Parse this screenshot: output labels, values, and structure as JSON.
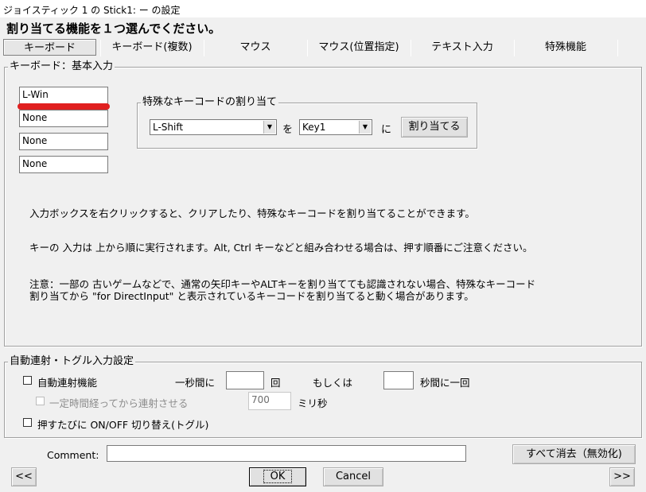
{
  "window": {
    "title": "ジョイスティック 1 の Stick1: ー の設定"
  },
  "heading": "割り当てる機能を１つ選んでください。",
  "tabs": [
    {
      "label": "キーボード",
      "active": true
    },
    {
      "label": "キーボード(複数)",
      "active": false
    },
    {
      "label": "マウス",
      "active": false
    },
    {
      "label": "マウス(位置指定)",
      "active": false
    },
    {
      "label": "テキスト入力",
      "active": false
    },
    {
      "label": "特殊機能",
      "active": false
    }
  ],
  "keyboard_group": {
    "label": "キーボード：基本入力",
    "key_inputs": [
      "L-Win",
      "None",
      "None",
      "None"
    ],
    "special": {
      "label": "特殊なキーコードの割り当て",
      "source_key": "L-Shift",
      "wo": "を",
      "target_key": "Key1",
      "ni": "に",
      "assign_button": "割り当てる"
    },
    "info": {
      "line1": "入力ボックスを右クリックすると、クリアしたり、特殊なキーコードを割り当てることができます。",
      "line2": "キーの 入力は 上から順に実行されます。Alt, Ctrl キーなどと組み合わせる場合は、押す順番にご注意ください。",
      "line3a": "注意：一部の 古いゲームなどで、通常の矢印キーやALTキーを割り当てても認識されない場合、特殊なキーコード",
      "line3b": "割り当てから \"for DirectInput\" と表示されているキーコードを割り当てると動く場合があります。"
    }
  },
  "autofire_group": {
    "label": "自動連射・トグル入力設定",
    "autofire_label": "自動連射機能",
    "per_second_label": "一秒間に",
    "per_second_value": "",
    "times_label": "回",
    "or_label": "もしくは",
    "seconds_value": "",
    "seconds_label": "秒間に一回",
    "delay_label": "一定時間経ってから連射させる",
    "delay_value": "700",
    "ms_label": "ミリ秒",
    "toggle_label": "押すたびに ON/OFF 切り替え(トグル)"
  },
  "comment": {
    "label": "Comment:",
    "value": ""
  },
  "buttons": {
    "clear_all": "すべて消去（無効化)",
    "prev": "<<",
    "ok": "OK",
    "cancel": "Cancel",
    "next": ">>"
  },
  "colors": {
    "annotation_red": "#e02020"
  }
}
